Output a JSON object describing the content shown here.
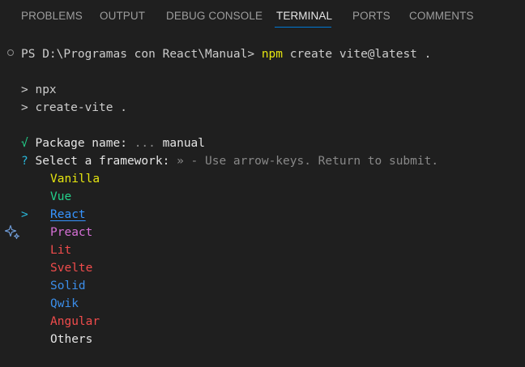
{
  "panel_tabs": [
    {
      "label": "PROBLEMS",
      "active": false
    },
    {
      "label": "OUTPUT",
      "active": false
    },
    {
      "label": "DEBUG CONSOLE",
      "active": false
    },
    {
      "label": "TERMINAL",
      "active": true
    },
    {
      "label": "PORTS",
      "active": false
    },
    {
      "label": "COMMENTS",
      "active": false
    }
  ],
  "terminal": {
    "prompt": "PS D:\\Programas con React\\Manual>",
    "command_npm": "npm",
    "command_rest": "create vite@latest .",
    "npx_prefix": ">",
    "npx_text": "npx",
    "create_prefix": ">",
    "create_text": "create-vite .",
    "check_mark": "√",
    "package_label": "Package name:",
    "package_ellipsis": "...",
    "package_value": "manual",
    "question_mark": "?",
    "framework_label": "Select a framework:",
    "framework_hint": "» - Use arrow-keys. Return to submit.",
    "selected_pointer": ">",
    "options": [
      {
        "label": "Vanilla",
        "color": "#e5e510",
        "selected": false
      },
      {
        "label": "Vue",
        "color": "#23d18b",
        "selected": false
      },
      {
        "label": "React",
        "color": "#3794ff",
        "selected": true
      },
      {
        "label": "Preact",
        "color": "#d670d6",
        "selected": false
      },
      {
        "label": "Lit",
        "color": "#f14c4c",
        "selected": false
      },
      {
        "label": "Svelte",
        "color": "#f14c4c",
        "selected": false
      },
      {
        "label": "Solid",
        "color": "#3b8eea",
        "selected": false
      },
      {
        "label": "Qwik",
        "color": "#3b8eea",
        "selected": false
      },
      {
        "label": "Angular",
        "color": "#f14c4c",
        "selected": false
      },
      {
        "label": "Others",
        "color": "#e5e5e5",
        "selected": false
      }
    ]
  },
  "colors": {
    "background": "#1f1f1f",
    "text": "#cccccc",
    "command_yellow": "#e5e510",
    "green": "#23d18b",
    "cyan": "#29b8db",
    "muted": "#888888",
    "accent": "#0078d4"
  }
}
